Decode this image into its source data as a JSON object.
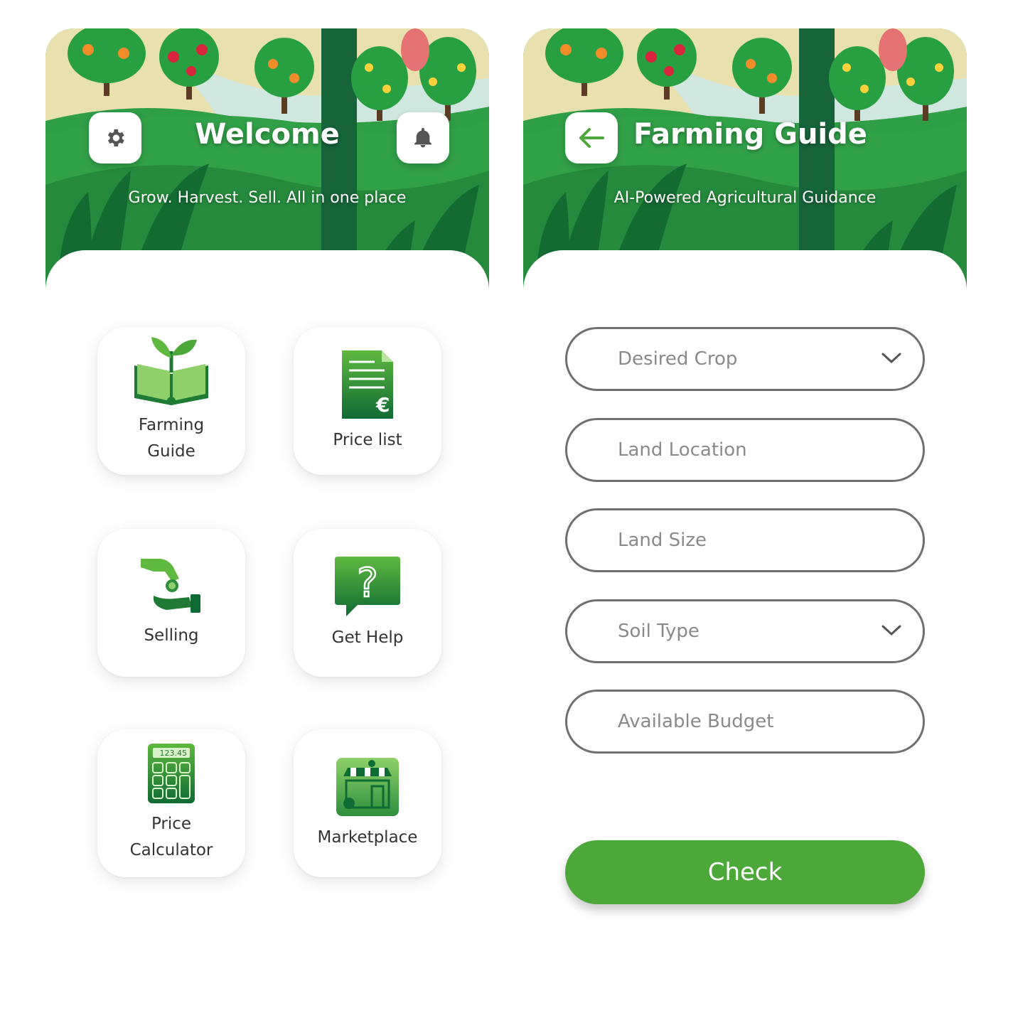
{
  "home": {
    "title": "Welcome",
    "subtitle": "Grow. Harvest. Sell. All in one place",
    "tiles": [
      {
        "label": "Farming\nGuide",
        "icon": "book-sprout-icon"
      },
      {
        "label": "Price list",
        "icon": "price-list-icon"
      },
      {
        "label": "Selling",
        "icon": "coin-hand-icon"
      },
      {
        "label": "Get Help",
        "icon": "question-bubble-icon"
      },
      {
        "label": "Price\nCalculator",
        "icon": "calculator-icon",
        "display": "123.45"
      },
      {
        "label": "Marketplace",
        "icon": "market-stall-icon"
      }
    ]
  },
  "guide": {
    "title": "Farming Guide",
    "subtitle": "AI-Powered Agricultural Guidance",
    "fields": [
      {
        "placeholder": "Desired Crop",
        "type": "select"
      },
      {
        "placeholder": "Land Location",
        "type": "text"
      },
      {
        "placeholder": "Land Size",
        "type": "text"
      },
      {
        "placeholder": "Soil Type",
        "type": "select"
      },
      {
        "placeholder": "Available Budget",
        "type": "text"
      }
    ],
    "submit_label": "Check"
  },
  "colors": {
    "brand_green": "#4da83a",
    "hero_green": "#2e9e47",
    "dark_green": "#0f6b34"
  }
}
